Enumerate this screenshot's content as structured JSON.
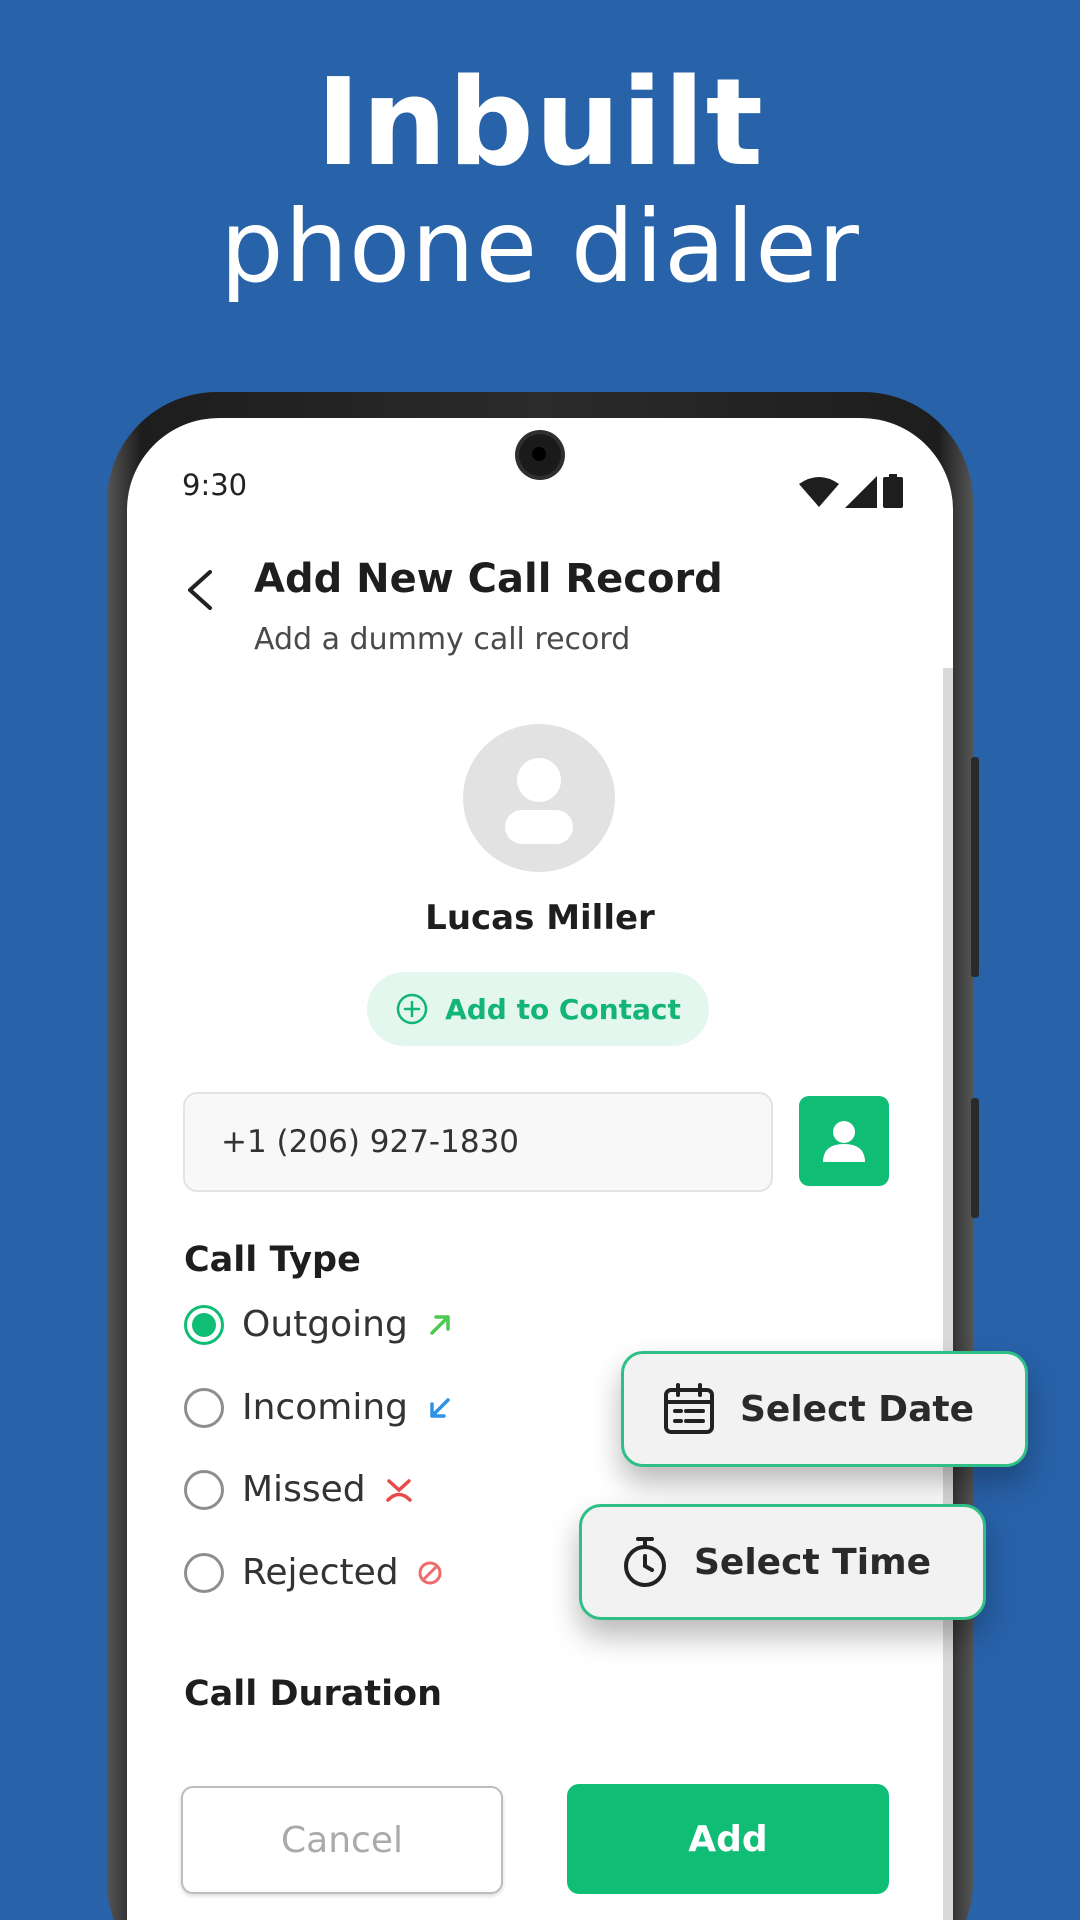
{
  "headline": {
    "line1": "Inbuilt",
    "line2": "phone dialer"
  },
  "status_bar": {
    "time": "9:30",
    "icons": [
      "wifi-icon",
      "signal-icon",
      "battery-icon"
    ]
  },
  "header": {
    "title": "Add New Call Record",
    "subtitle": "Add a dummy call record"
  },
  "contact": {
    "name": "Lucas Miller",
    "add_label": "Add to Contact"
  },
  "phone_field": {
    "value": "+1 (206) 927-1830"
  },
  "call_type": {
    "label": "Call Type",
    "options": [
      {
        "label": "Outgoing",
        "checked": true,
        "icon": "outgoing-arrow-icon",
        "color": "#4cc94f"
      },
      {
        "label": "Incoming",
        "checked": false,
        "icon": "incoming-arrow-icon",
        "color": "#2a93e8"
      },
      {
        "label": "Missed",
        "checked": false,
        "icon": "missed-call-icon",
        "color": "#e84a4a"
      },
      {
        "label": "Rejected",
        "checked": false,
        "icon": "rejected-icon",
        "color": "#ef6a6a"
      }
    ]
  },
  "call_duration": {
    "label": "Call Duration"
  },
  "actions": {
    "cancel": "Cancel",
    "add": "Add"
  },
  "floating": {
    "date": "Select Date",
    "time": "Select Time"
  },
  "colors": {
    "background": "#2862a9",
    "accent": "#0fbd75",
    "accent_light": "#e3f7ee"
  }
}
